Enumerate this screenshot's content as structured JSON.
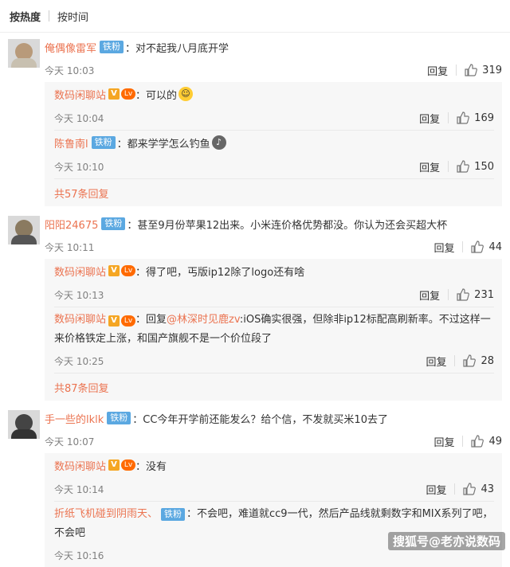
{
  "sort": {
    "hot": "按热度",
    "time": "按时间"
  },
  "comments": [
    {
      "user": "俺偶像雷军",
      "badge": "铁粉",
      "text": "：对不起我八月底开学",
      "time": "今天 10:03",
      "reply": "回复",
      "likes": "319",
      "replies": [
        {
          "user": "数码闲聊站",
          "text": "：可以的",
          "time": "今天 10:04",
          "reply": "回复",
          "likes": "169"
        },
        {
          "user": "陈鲁南l",
          "badge": "铁粉",
          "text": "：都来学学怎么钓鱼",
          "time": "今天 10:10",
          "reply": "回复",
          "likes": "150"
        }
      ],
      "more": "共57条回复"
    },
    {
      "user": "阳阳24675",
      "badge": "铁粉",
      "text": "：甚至9月份苹果12出来。小米连价格优势都没。你认为还会买超大杯",
      "time": "今天 10:11",
      "reply": "回复",
      "likes": "44",
      "replies": [
        {
          "user": "数码闲聊站",
          "text": "：得了吧，丐版ip12除了logo还有啥",
          "time": "今天 10:13",
          "reply": "回复",
          "likes": "231"
        },
        {
          "user": "数码闲聊站",
          "text_pre": "：回复",
          "mention": "@林深时见鹿zv",
          "text": ":iOS确实很强，但除非ip12标配高刷新率。不过这样一来价格铁定上涨，和国产旗舰不是一个价位段了",
          "time": "今天 10:25",
          "reply": "回复",
          "likes": "28"
        }
      ],
      "more": "共87条回复"
    },
    {
      "user": "手一些的lklk",
      "badge": "铁粉",
      "text": "：CC今年开学前还能发么？给个信，不发就买米10去了",
      "time": "今天 10:07",
      "reply": "回复",
      "likes": "49",
      "replies": [
        {
          "user": "数码闲聊站",
          "text": "：没有",
          "time": "今天 10:14",
          "reply": "回复",
          "likes": "43"
        },
        {
          "user": "折纸飞机碰到阴雨天、",
          "badge": "铁粉",
          "text": "：不会吧，难道就cc9一代，然后产品线就剩数字和MIX系列了吧，不会吧",
          "time": "今天 10:16"
        }
      ]
    }
  ],
  "watermark": "搜狐号@老亦说数码"
}
